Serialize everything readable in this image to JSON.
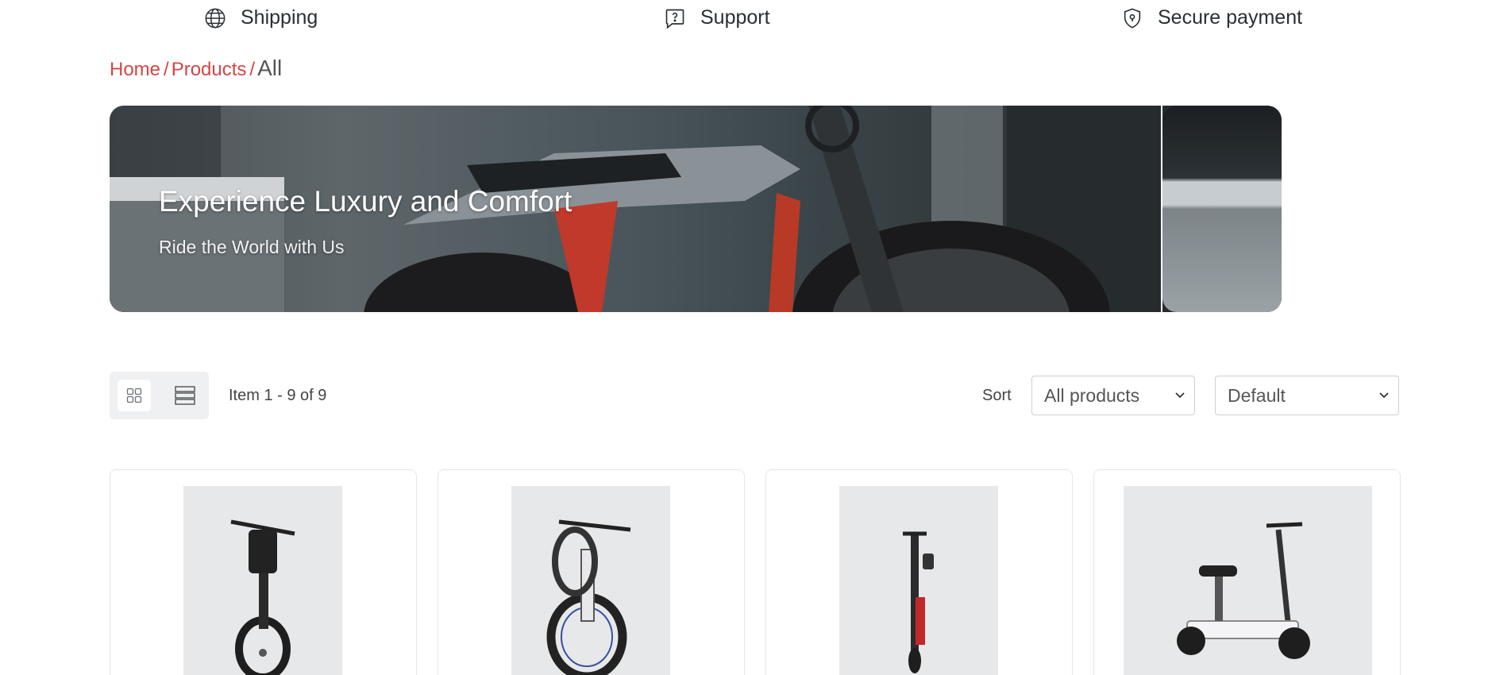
{
  "features": [
    {
      "label": "Shipping",
      "icon": "globe-icon"
    },
    {
      "label": "Support",
      "icon": "question-bubble-icon"
    },
    {
      "label": "Secure payment",
      "icon": "shield-icon"
    }
  ],
  "breadcrumb": {
    "home": "Home",
    "sep1": "/",
    "products": "Products",
    "sep2": "/",
    "current": "All"
  },
  "hero": {
    "title": "Experience Luxury and Comfort",
    "subtitle": "Ride the World with Us"
  },
  "toolbar": {
    "item_count": "Item 1 - 9 of 9",
    "sort_label": "Sort",
    "filter_value": "All products",
    "order_value": "Default"
  },
  "colors": {
    "link": "#d64545",
    "text": "#2a2f33"
  },
  "products": [
    {
      "name": "Fat tire electric bike (front view)",
      "icon": "ebike-image"
    },
    {
      "name": "Fat tire electric bike (angled view)",
      "icon": "ebike-image"
    },
    {
      "name": "Folding electric scooter",
      "icon": "scooter-image"
    },
    {
      "name": "Electric scooter with seat",
      "icon": "seated-scooter-image"
    }
  ]
}
